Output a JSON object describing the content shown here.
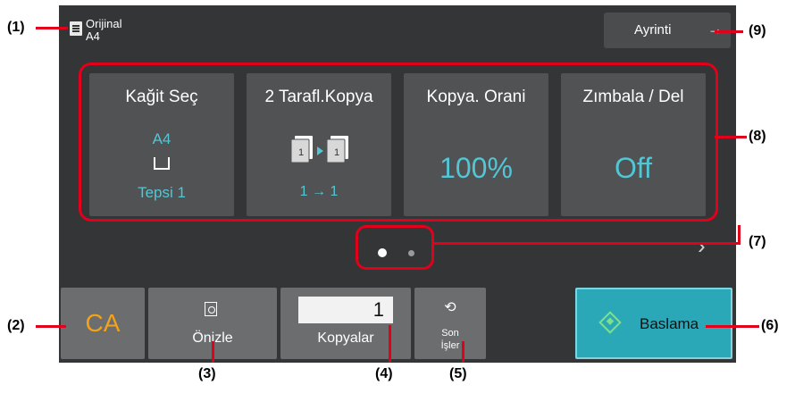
{
  "original": {
    "label": "Orijinal",
    "size": "A4"
  },
  "detail_button": {
    "label": "Ayrinti",
    "icon": "arrow-right-icon"
  },
  "tiles": [
    {
      "title": "Kağit Seç",
      "paper_size": "A4",
      "tray": "Tepsi 1",
      "icon": "tray-icon"
    },
    {
      "title": "2 Tarafl.Kopya",
      "value": "1 → 1",
      "icon": "duplex-copy-icon"
    },
    {
      "title": "Kopya. Orani",
      "value": "100%"
    },
    {
      "title": "Zımbala / Del",
      "value": "Off"
    }
  ],
  "page_indicator": {
    "pages": 2,
    "current": 1
  },
  "bottom": {
    "ca_label": "CA",
    "preview_label": "Önizle",
    "copies_value": "1",
    "copies_label": "Kopyalar",
    "recent_label_1": "Son",
    "recent_label_2": "İşler",
    "start_label": "Baslama"
  },
  "callouts": [
    "(1)",
    "(2)",
    "(3)",
    "(4)",
    "(5)",
    "(6)",
    "(7)",
    "(8)",
    "(9)"
  ],
  "colors": {
    "accent_red": "#e2001a",
    "value_cyan": "#53c6d6",
    "ca_orange": "#f3a21c",
    "start_teal": "#2aa8b8"
  }
}
